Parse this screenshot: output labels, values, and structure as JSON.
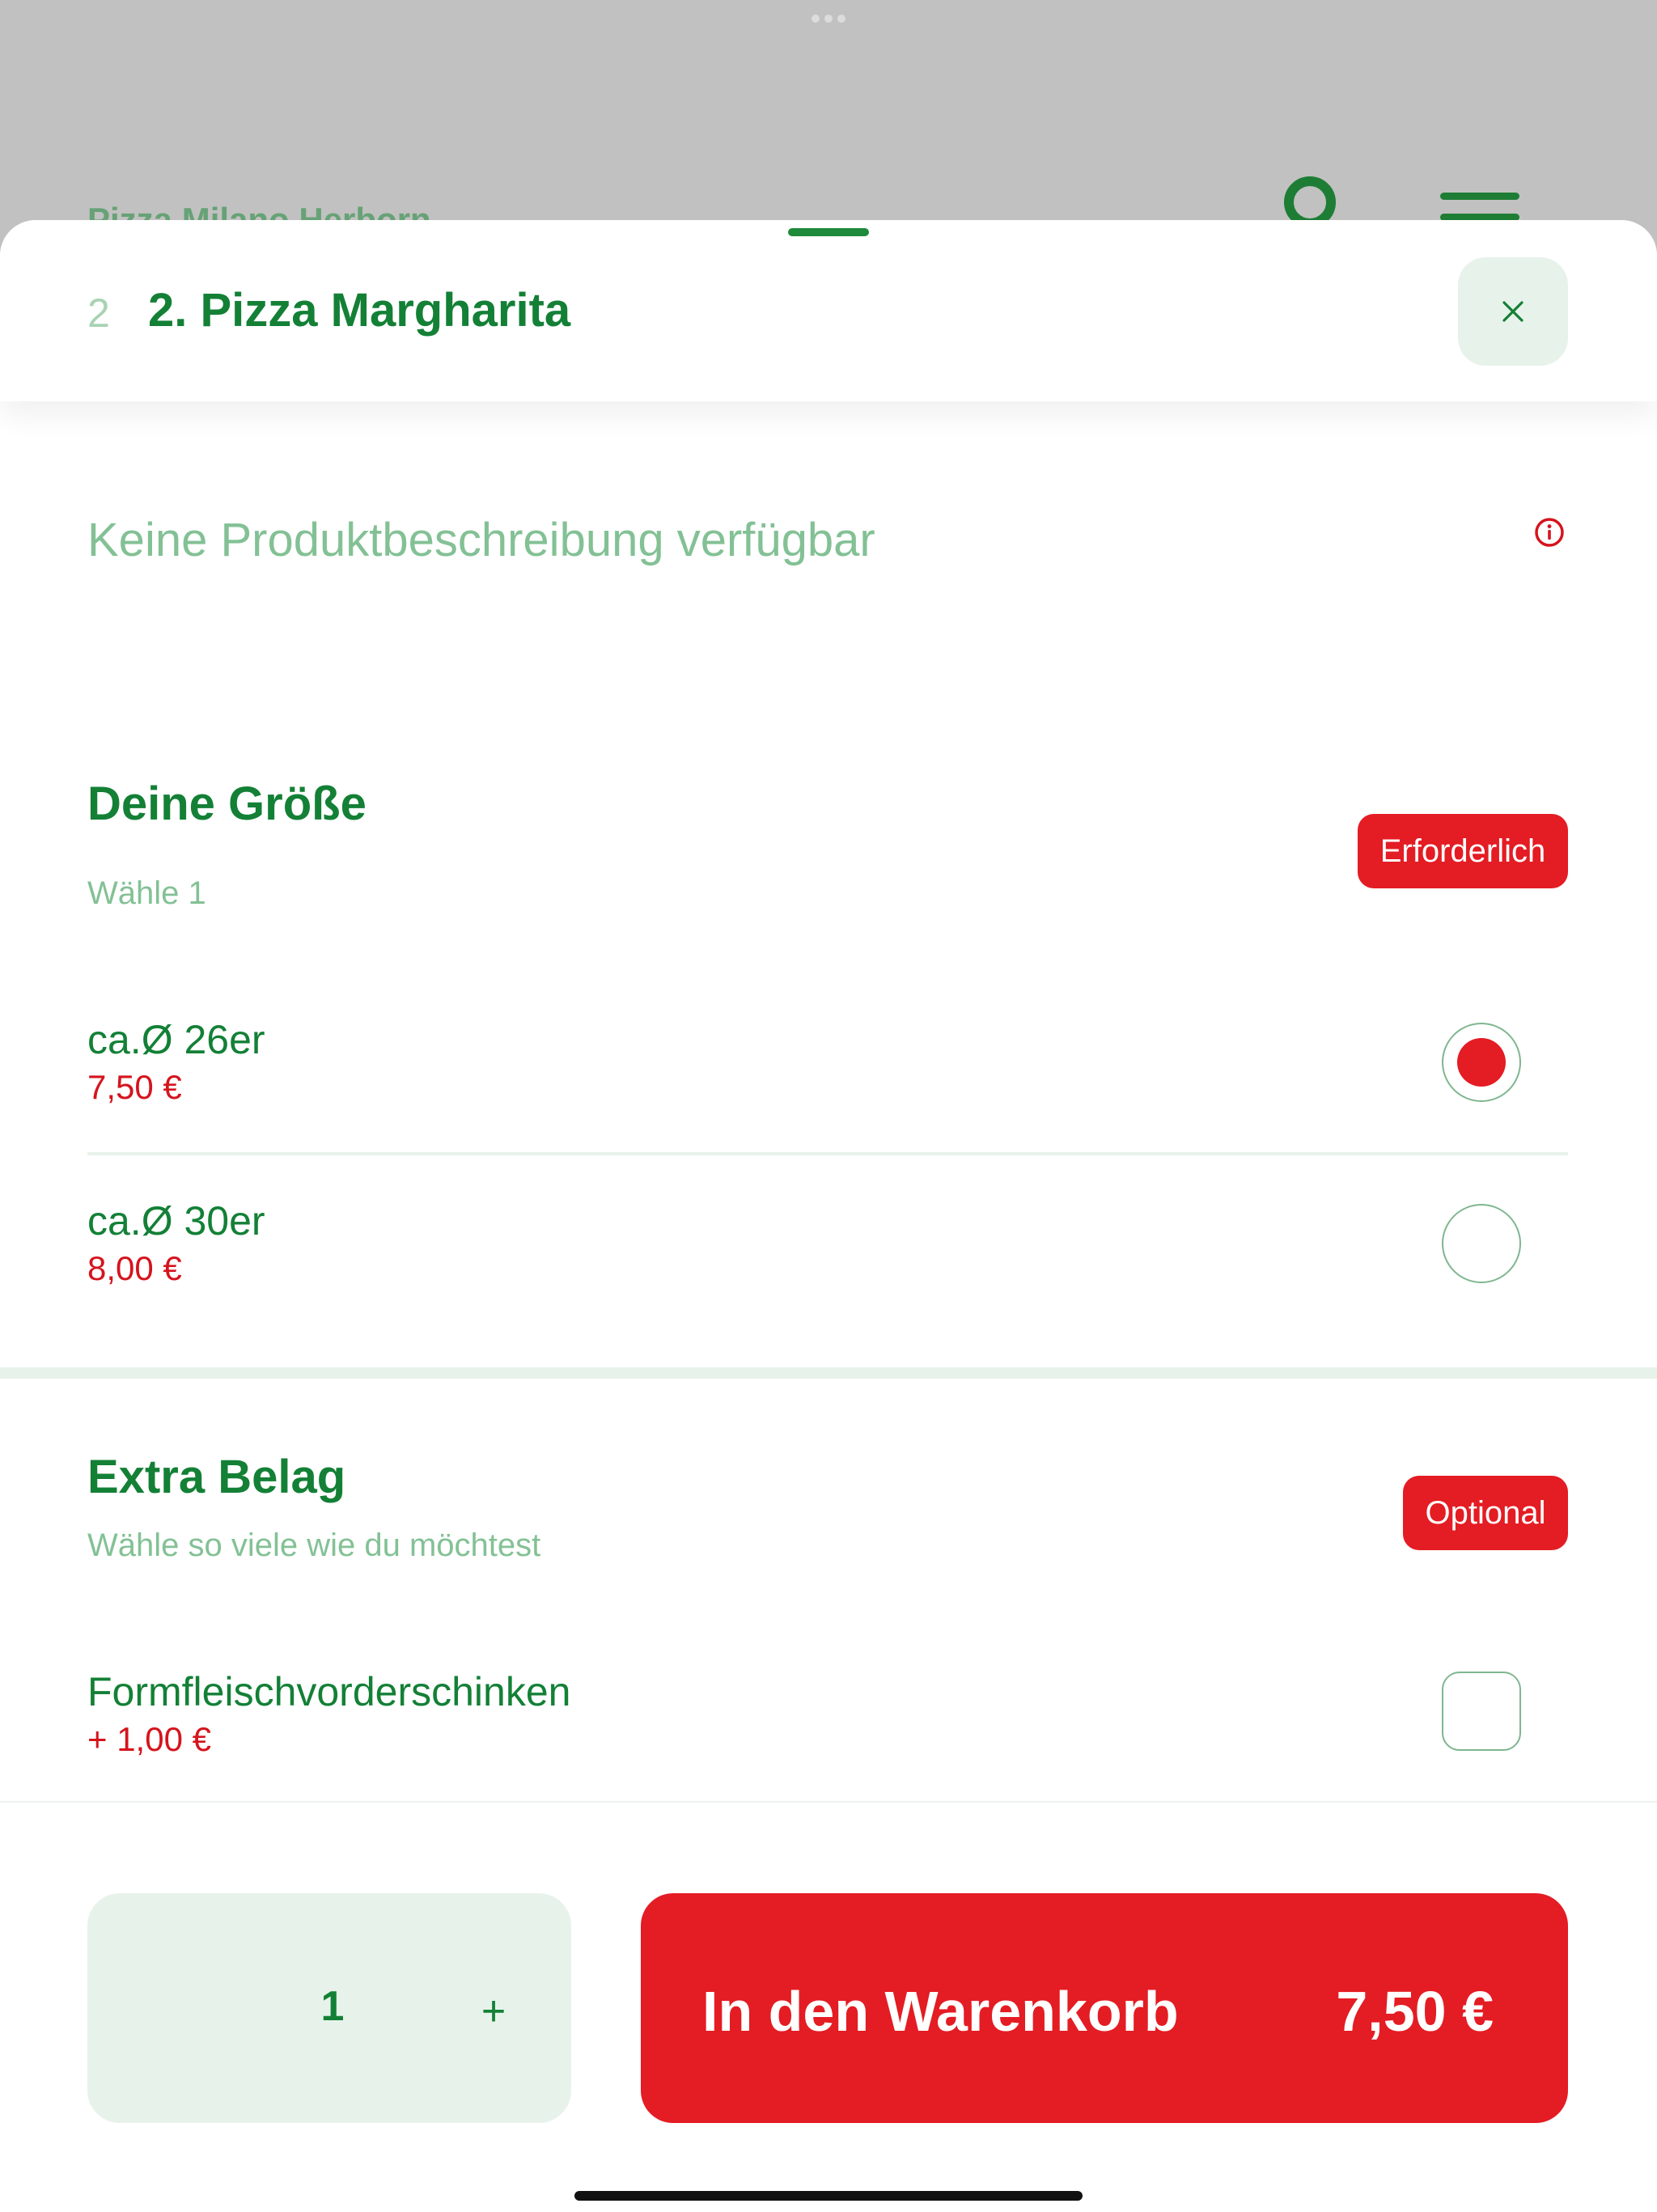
{
  "background": {
    "restaurant_title": "Pizza Milano Herborn"
  },
  "item": {
    "number": "2",
    "title": "2. Pizza Margharita",
    "description": "Keine Produktbeschreibung verfügbar"
  },
  "sections": {
    "size": {
      "title": "Deine Größe",
      "subtitle": "Wähle 1",
      "badge": "Erforderlich",
      "options": [
        {
          "name": "ca.Ø 26er",
          "price": "7,50 €",
          "selected": true
        },
        {
          "name": "ca.Ø 30er",
          "price": "8,00 €",
          "selected": false
        }
      ]
    },
    "extras": {
      "title": "Extra Belag",
      "subtitle": "Wähle so viele wie du möchtest",
      "badge": "Optional",
      "options": [
        {
          "name": "Formfleischvorderschinken",
          "price": "+ 1,00 €",
          "checked": false
        }
      ]
    }
  },
  "footer": {
    "quantity": "1",
    "plus_label": "+",
    "cart_label": "In den Warenkorb",
    "cart_price": "7,50 €"
  },
  "colors": {
    "brand_green": "#138036",
    "accent_red": "#e41c23",
    "soft_green": "#e7f3ea"
  },
  "icons": {
    "close": "close-icon",
    "info": "info-icon"
  }
}
